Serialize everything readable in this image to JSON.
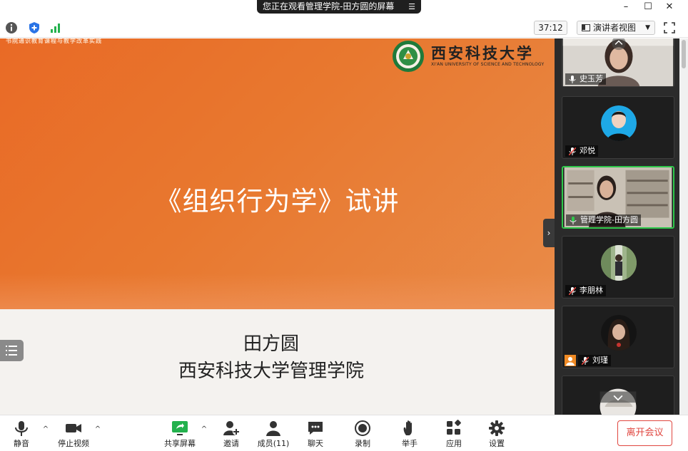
{
  "titlebar": {
    "viewing_text": "您正在观看管理学院-田方圆的屏幕",
    "menu_glyph": "☰",
    "minimize_glyph": "–",
    "maximize_glyph": "☐",
    "close_glyph": "✕"
  },
  "toolbar": {
    "timer": "37:12",
    "view_label": "演讲者视图",
    "view_caret": "▼"
  },
  "slide": {
    "header_text": "书院通识教育课程与教学改革实践",
    "university_cn": "西安科技大学",
    "university_en": "XI'AN UNIVERSITY OF SCIENCE AND TECHNOLOGY",
    "title": "《组织行为学》试讲",
    "presenter_name": "田方圆",
    "presenter_org": "西安科技大学管理学院"
  },
  "side_panel": {
    "collapse_glyph": "›",
    "participants": [
      {
        "name": "史玉芳",
        "muted": false,
        "style": "video"
      },
      {
        "name": "邓悦",
        "muted": true,
        "style": "avatar-blue"
      },
      {
        "name": "管理学院-田方圆",
        "muted": false,
        "active": true,
        "style": "video-shelf"
      },
      {
        "name": "李朋林",
        "muted": true,
        "style": "avatar-green"
      },
      {
        "name": "刘瑾",
        "muted": true,
        "style": "avatar-dark"
      },
      {
        "name": "",
        "muted": true,
        "style": "video-partial"
      }
    ]
  },
  "bottom_bar": {
    "mute_label": "静音",
    "stop_video_label": "停止视频",
    "share_screen_label": "共享屏幕",
    "invite_label": "邀请",
    "participants_label": "成员(11)",
    "chat_label": "聊天",
    "record_label": "录制",
    "raise_hand_label": "举手",
    "apps_label": "应用",
    "settings_label": "设置",
    "leave_label": "离开会议",
    "caret": "^"
  },
  "colors": {
    "slide_orange": "#e8782f",
    "active_border": "#2fc84b",
    "leave_red": "#e0463f",
    "share_green": "#23b14d"
  }
}
